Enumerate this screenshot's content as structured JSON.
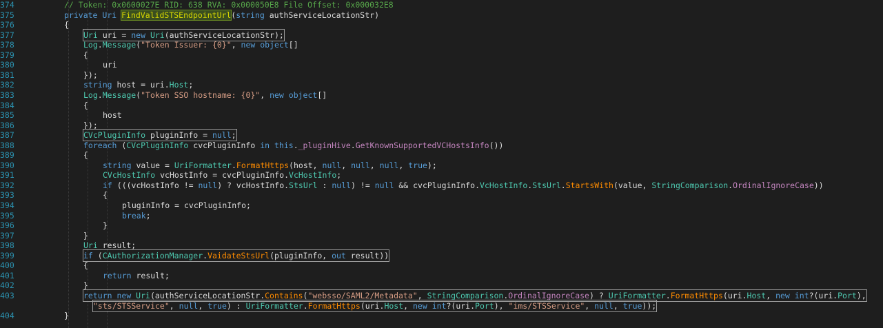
{
  "editor": {
    "lines": [
      {
        "num": "374",
        "indent": 0,
        "segments": [
          {
            "t": "// Token: 0x0600027E RID: 638 RVA: 0x000050E8 File Offset: 0x000032E8",
            "c": "cm"
          }
        ]
      },
      {
        "num": "375",
        "indent": 0,
        "segments": [
          {
            "t": "private ",
            "c": "kw"
          },
          {
            "t": "Uri ",
            "c": "kw"
          },
          {
            "t": "FindValidSTSEndpointUrl",
            "c": "hl-name"
          },
          {
            "t": "(",
            "c": "ident"
          },
          {
            "t": "string ",
            "c": "kw"
          },
          {
            "t": "authServiceLocationStr)",
            "c": "ident"
          }
        ]
      },
      {
        "num": "376",
        "indent": 0,
        "segments": [
          {
            "t": "{",
            "c": "ident"
          }
        ]
      },
      {
        "num": "377",
        "indent": 1,
        "box": true,
        "segments": [
          {
            "t": "Uri ",
            "c": "ty"
          },
          {
            "t": "uri = ",
            "c": "ident"
          },
          {
            "t": "new ",
            "c": "kw"
          },
          {
            "t": "Uri",
            "c": "ty"
          },
          {
            "t": "(authServiceLocationStr);",
            "c": "ident"
          }
        ]
      },
      {
        "num": "378",
        "indent": 1,
        "segments": [
          {
            "t": "Log",
            "c": "ty"
          },
          {
            "t": ".",
            "c": "ident"
          },
          {
            "t": "Message",
            "c": "mem"
          },
          {
            "t": "(",
            "c": "ident"
          },
          {
            "t": "\"Token Issuer: {0}\"",
            "c": "str"
          },
          {
            "t": ", ",
            "c": "ident"
          },
          {
            "t": "new ",
            "c": "kw"
          },
          {
            "t": "object",
            "c": "kw"
          },
          {
            "t": "[]",
            "c": "ident"
          }
        ]
      },
      {
        "num": "379",
        "indent": 1,
        "segments": [
          {
            "t": "{",
            "c": "ident"
          }
        ]
      },
      {
        "num": "380",
        "indent": 2,
        "segments": [
          {
            "t": "uri",
            "c": "ident"
          }
        ]
      },
      {
        "num": "381",
        "indent": 1,
        "segments": [
          {
            "t": "});",
            "c": "ident"
          }
        ]
      },
      {
        "num": "382",
        "indent": 1,
        "segments": [
          {
            "t": "string ",
            "c": "kw"
          },
          {
            "t": "host = uri.",
            "c": "ident"
          },
          {
            "t": "Host",
            "c": "mem"
          },
          {
            "t": ";",
            "c": "ident"
          }
        ]
      },
      {
        "num": "383",
        "indent": 1,
        "segments": [
          {
            "t": "Log",
            "c": "ty"
          },
          {
            "t": ".",
            "c": "ident"
          },
          {
            "t": "Message",
            "c": "mem"
          },
          {
            "t": "(",
            "c": "ident"
          },
          {
            "t": "\"Token SSO hostname: {0}\"",
            "c": "str"
          },
          {
            "t": ", ",
            "c": "ident"
          },
          {
            "t": "new ",
            "c": "kw"
          },
          {
            "t": "object",
            "c": "kw"
          },
          {
            "t": "[]",
            "c": "ident"
          }
        ]
      },
      {
        "num": "384",
        "indent": 1,
        "segments": [
          {
            "t": "{",
            "c": "ident"
          }
        ]
      },
      {
        "num": "385",
        "indent": 2,
        "segments": [
          {
            "t": "host",
            "c": "ident"
          }
        ]
      },
      {
        "num": "386",
        "indent": 1,
        "segments": [
          {
            "t": "});",
            "c": "ident"
          }
        ]
      },
      {
        "num": "387",
        "indent": 1,
        "box": true,
        "segments": [
          {
            "t": "CVcPluginInfo ",
            "c": "ty"
          },
          {
            "t": "pluginInfo = ",
            "c": "ident"
          },
          {
            "t": "null",
            "c": "kw"
          },
          {
            "t": ";",
            "c": "ident"
          }
        ]
      },
      {
        "num": "388",
        "indent": 1,
        "segments": [
          {
            "t": "foreach ",
            "c": "kw"
          },
          {
            "t": "(",
            "c": "ident"
          },
          {
            "t": "CVcPluginInfo ",
            "c": "ty"
          },
          {
            "t": "cvcPluginInfo ",
            "c": "ident"
          },
          {
            "t": "in ",
            "c": "kw"
          },
          {
            "t": "this",
            "c": "kw"
          },
          {
            "t": ".",
            "c": "ident"
          },
          {
            "t": "_pluginHive",
            "c": "fld"
          },
          {
            "t": ".",
            "c": "ident"
          },
          {
            "t": "GetKnownSupportedVCHostsInfo",
            "c": "fld"
          },
          {
            "t": "())",
            "c": "ident"
          }
        ]
      },
      {
        "num": "389",
        "indent": 1,
        "segments": [
          {
            "t": "{",
            "c": "ident"
          }
        ]
      },
      {
        "num": "390",
        "indent": 2,
        "segments": [
          {
            "t": "string ",
            "c": "kw"
          },
          {
            "t": "value = ",
            "c": "ident"
          },
          {
            "t": "UriFormatter",
            "c": "ty"
          },
          {
            "t": ".",
            "c": "ident"
          },
          {
            "t": "FormatHttps",
            "c": "fn"
          },
          {
            "t": "(host, ",
            "c": "ident"
          },
          {
            "t": "null",
            "c": "kw"
          },
          {
            "t": ", ",
            "c": "ident"
          },
          {
            "t": "null",
            "c": "kw"
          },
          {
            "t": ", ",
            "c": "ident"
          },
          {
            "t": "null",
            "c": "kw"
          },
          {
            "t": ", ",
            "c": "ident"
          },
          {
            "t": "true",
            "c": "kw"
          },
          {
            "t": ");",
            "c": "ident"
          }
        ]
      },
      {
        "num": "391",
        "indent": 2,
        "segments": [
          {
            "t": "CVcHostInfo ",
            "c": "ty"
          },
          {
            "t": "vcHostInfo = cvcPluginInfo.",
            "c": "ident"
          },
          {
            "t": "VcHostInfo",
            "c": "mem"
          },
          {
            "t": ";",
            "c": "ident"
          }
        ]
      },
      {
        "num": "392",
        "indent": 2,
        "segments": [
          {
            "t": "if ",
            "c": "kw"
          },
          {
            "t": "(((vcHostInfo != ",
            "c": "ident"
          },
          {
            "t": "null",
            "c": "kw"
          },
          {
            "t": ") ? vcHostInfo.",
            "c": "ident"
          },
          {
            "t": "StsUrl",
            "c": "mem"
          },
          {
            "t": " : ",
            "c": "ident"
          },
          {
            "t": "null",
            "c": "kw"
          },
          {
            "t": ") != ",
            "c": "ident"
          },
          {
            "t": "null",
            "c": "kw"
          },
          {
            "t": " && cvcPluginInfo.",
            "c": "ident"
          },
          {
            "t": "VcHostInfo",
            "c": "mem"
          },
          {
            "t": ".",
            "c": "ident"
          },
          {
            "t": "StsUrl",
            "c": "mem"
          },
          {
            "t": ".",
            "c": "ident"
          },
          {
            "t": "StartsWith",
            "c": "fn"
          },
          {
            "t": "(value, ",
            "c": "ident"
          },
          {
            "t": "StringComparison",
            "c": "ty"
          },
          {
            "t": ".",
            "c": "ident"
          },
          {
            "t": "OrdinalIgnoreCase",
            "c": "fld"
          },
          {
            "t": "))",
            "c": "ident"
          }
        ]
      },
      {
        "num": "393",
        "indent": 2,
        "segments": [
          {
            "t": "{",
            "c": "ident"
          }
        ]
      },
      {
        "num": "394",
        "indent": 3,
        "segments": [
          {
            "t": "pluginInfo = cvcPluginInfo;",
            "c": "ident"
          }
        ]
      },
      {
        "num": "395",
        "indent": 3,
        "segments": [
          {
            "t": "break",
            "c": "kw"
          },
          {
            "t": ";",
            "c": "ident"
          }
        ]
      },
      {
        "num": "396",
        "indent": 2,
        "segments": [
          {
            "t": "}",
            "c": "ident"
          }
        ]
      },
      {
        "num": "397",
        "indent": 1,
        "segments": [
          {
            "t": "}",
            "c": "ident"
          }
        ]
      },
      {
        "num": "398",
        "indent": 1,
        "segments": [
          {
            "t": "Uri ",
            "c": "ty"
          },
          {
            "t": "result;",
            "c": "ident"
          }
        ]
      },
      {
        "num": "399",
        "indent": 1,
        "box": true,
        "segments": [
          {
            "t": "if ",
            "c": "kw"
          },
          {
            "t": "(",
            "c": "ident"
          },
          {
            "t": "CAuthorizationManager",
            "c": "ty"
          },
          {
            "t": ".",
            "c": "ident"
          },
          {
            "t": "VaidateStsUrl",
            "c": "fn"
          },
          {
            "t": "(pluginInfo, ",
            "c": "ident"
          },
          {
            "t": "out ",
            "c": "kw"
          },
          {
            "t": "result))",
            "c": "ident"
          }
        ]
      },
      {
        "num": "400",
        "indent": 1,
        "segments": [
          {
            "t": "{",
            "c": "ident"
          }
        ]
      },
      {
        "num": "401",
        "indent": 2,
        "segments": [
          {
            "t": "return ",
            "c": "kw"
          },
          {
            "t": "result;",
            "c": "ident"
          }
        ]
      },
      {
        "num": "402",
        "indent": 1,
        "segments": [
          {
            "t": "}",
            "c": "ident"
          }
        ]
      },
      {
        "num": "403",
        "indent": 1,
        "box": true,
        "segments": [
          {
            "t": "return ",
            "c": "kw"
          },
          {
            "t": "new ",
            "c": "kw"
          },
          {
            "t": "Uri",
            "c": "ty"
          },
          {
            "t": "(authServiceLocationStr.",
            "c": "ident"
          },
          {
            "t": "Contains",
            "c": "fn"
          },
          {
            "t": "(",
            "c": "ident"
          },
          {
            "t": "\"websso/SAML2/Metadata\"",
            "c": "str"
          },
          {
            "t": ", ",
            "c": "ident"
          },
          {
            "t": "StringComparison",
            "c": "ty"
          },
          {
            "t": ".",
            "c": "ident"
          },
          {
            "t": "OrdinalIgnoreCase",
            "c": "fld"
          },
          {
            "t": ") ? ",
            "c": "ident"
          },
          {
            "t": "UriFormatter",
            "c": "ty"
          },
          {
            "t": ".",
            "c": "ident"
          },
          {
            "t": "FormatHttps",
            "c": "fn"
          },
          {
            "t": "(uri.",
            "c": "ident"
          },
          {
            "t": "Host",
            "c": "mem"
          },
          {
            "t": ", ",
            "c": "ident"
          },
          {
            "t": "new ",
            "c": "kw"
          },
          {
            "t": "int",
            "c": "kw"
          },
          {
            "t": "?(uri.",
            "c": "ident"
          },
          {
            "t": "Port",
            "c": "mem"
          },
          {
            "t": "),",
            "c": "ident"
          }
        ]
      },
      {
        "num": "",
        "indent": 1.5,
        "box": true,
        "segments": [
          {
            "t": "\"sts/STSService\"",
            "c": "str"
          },
          {
            "t": ", ",
            "c": "ident"
          },
          {
            "t": "null",
            "c": "kw"
          },
          {
            "t": ", ",
            "c": "ident"
          },
          {
            "t": "true",
            "c": "kw"
          },
          {
            "t": ") : ",
            "c": "ident"
          },
          {
            "t": "UriFormatter",
            "c": "ty"
          },
          {
            "t": ".",
            "c": "ident"
          },
          {
            "t": "FormatHttps",
            "c": "fn"
          },
          {
            "t": "(uri.",
            "c": "ident"
          },
          {
            "t": "Host",
            "c": "mem"
          },
          {
            "t": ", ",
            "c": "ident"
          },
          {
            "t": "new ",
            "c": "kw"
          },
          {
            "t": "int",
            "c": "kw"
          },
          {
            "t": "?(uri.",
            "c": "ident"
          },
          {
            "t": "Port",
            "c": "mem"
          },
          {
            "t": "), ",
            "c": "ident"
          },
          {
            "t": "\"ims/STSService\"",
            "c": "str"
          },
          {
            "t": ", ",
            "c": "ident"
          },
          {
            "t": "null",
            "c": "kw"
          },
          {
            "t": ", ",
            "c": "ident"
          },
          {
            "t": "true",
            "c": "kw"
          },
          {
            "t": "));",
            "c": "ident"
          }
        ]
      },
      {
        "num": "404",
        "indent": 0,
        "segments": [
          {
            "t": "}",
            "c": "ident"
          }
        ]
      }
    ]
  }
}
